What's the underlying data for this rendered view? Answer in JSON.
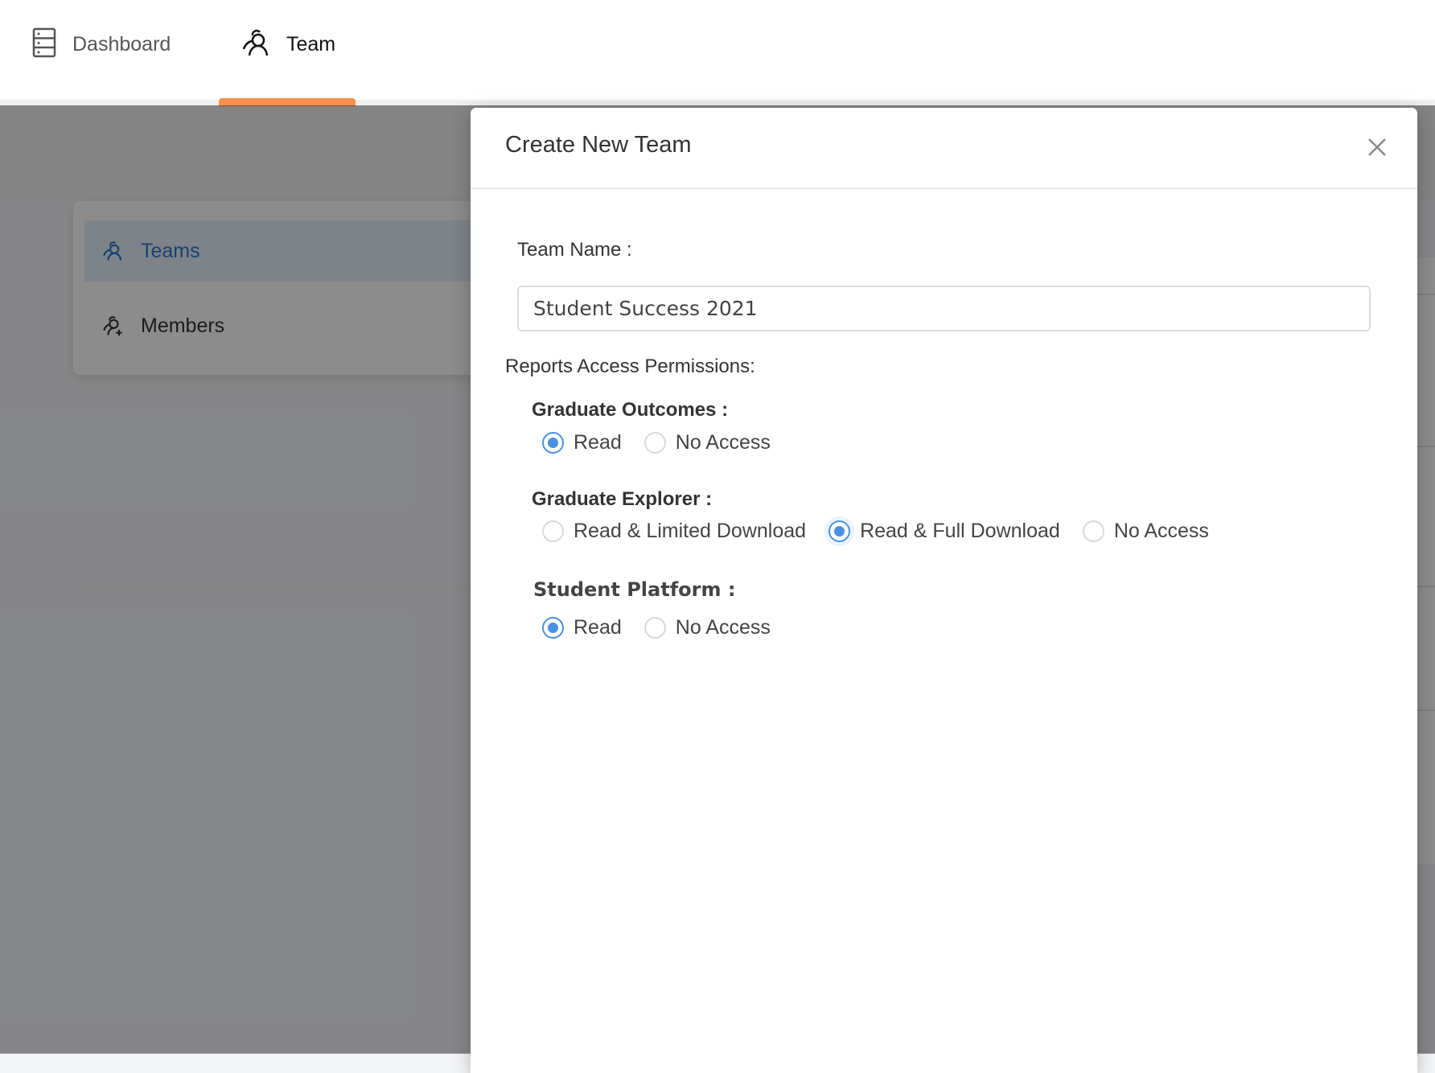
{
  "nav": {
    "items": [
      {
        "label": "Dashboard",
        "icon": "dashboard-server-icon",
        "active": false
      },
      {
        "label": "Team",
        "icon": "team-users-icon",
        "active": true
      }
    ],
    "accent_color": "#f7904c"
  },
  "sidebar": {
    "items": [
      {
        "label": "Teams",
        "icon": "team-users-icon",
        "active": true
      },
      {
        "label": "Members",
        "icon": "add-member-icon",
        "active": false
      }
    ],
    "active_color": "#2f79c7"
  },
  "modal": {
    "title": "Create New Team",
    "close_icon": "close-icon",
    "team_name_label": "Team Name :",
    "team_name_value": "Student Success 2021",
    "permissions_label": "Reports Access Permissions:",
    "groups": [
      {
        "title": "Graduate Outcomes :",
        "options": [
          "Read",
          "No Access"
        ],
        "selected": "Read"
      },
      {
        "title": "Graduate Explorer :",
        "options": [
          "Read & Limited Download",
          "Read & Full Download",
          "No Access"
        ],
        "selected": "Read & Full Download"
      },
      {
        "title": "Student Platform :",
        "options": [
          "Read",
          "No Access"
        ],
        "selected": "Read"
      }
    ],
    "radio_color": "#4a90e2"
  }
}
